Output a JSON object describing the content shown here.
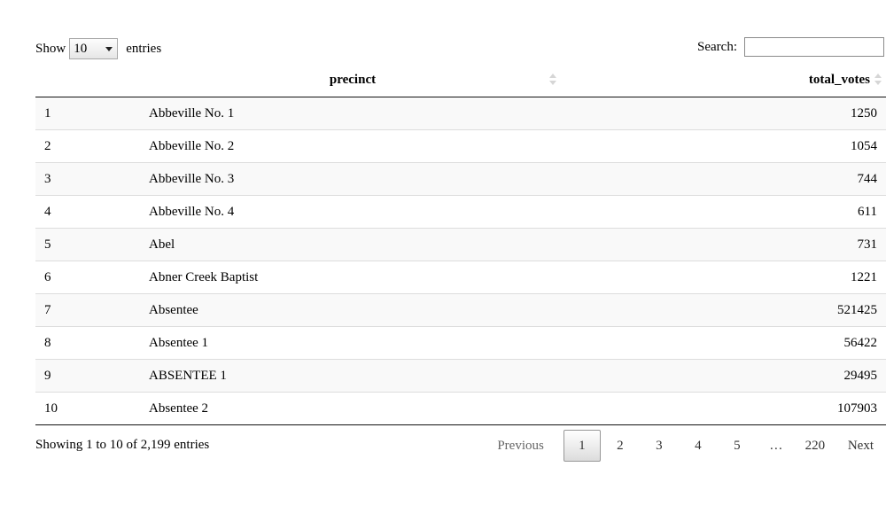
{
  "length": {
    "show_label": "Show",
    "selected": "10",
    "entries_label": "entries"
  },
  "search": {
    "label": "Search:",
    "value": ""
  },
  "columns": {
    "index": "",
    "precinct": "precinct",
    "total_votes": "total_votes"
  },
  "rows": [
    {
      "index": "1",
      "precinct": "Abbeville No. 1",
      "total_votes": "1250"
    },
    {
      "index": "2",
      "precinct": "Abbeville No. 2",
      "total_votes": "1054"
    },
    {
      "index": "3",
      "precinct": "Abbeville No. 3",
      "total_votes": "744"
    },
    {
      "index": "4",
      "precinct": "Abbeville No. 4",
      "total_votes": "611"
    },
    {
      "index": "5",
      "precinct": "Abel",
      "total_votes": "731"
    },
    {
      "index": "6",
      "precinct": "Abner Creek Baptist",
      "total_votes": "1221"
    },
    {
      "index": "7",
      "precinct": "Absentee",
      "total_votes": "521425"
    },
    {
      "index": "8",
      "precinct": "Absentee 1",
      "total_votes": "56422"
    },
    {
      "index": "9",
      "precinct": "ABSENTEE 1",
      "total_votes": "29495"
    },
    {
      "index": "10",
      "precinct": "Absentee 2",
      "total_votes": "107903"
    }
  ],
  "info": "Showing 1 to 10 of 2,199 entries",
  "pagination": {
    "previous": "Previous",
    "pages": [
      "1",
      "2",
      "3",
      "4",
      "5",
      "…",
      "220"
    ],
    "current": "1",
    "next": "Next"
  }
}
